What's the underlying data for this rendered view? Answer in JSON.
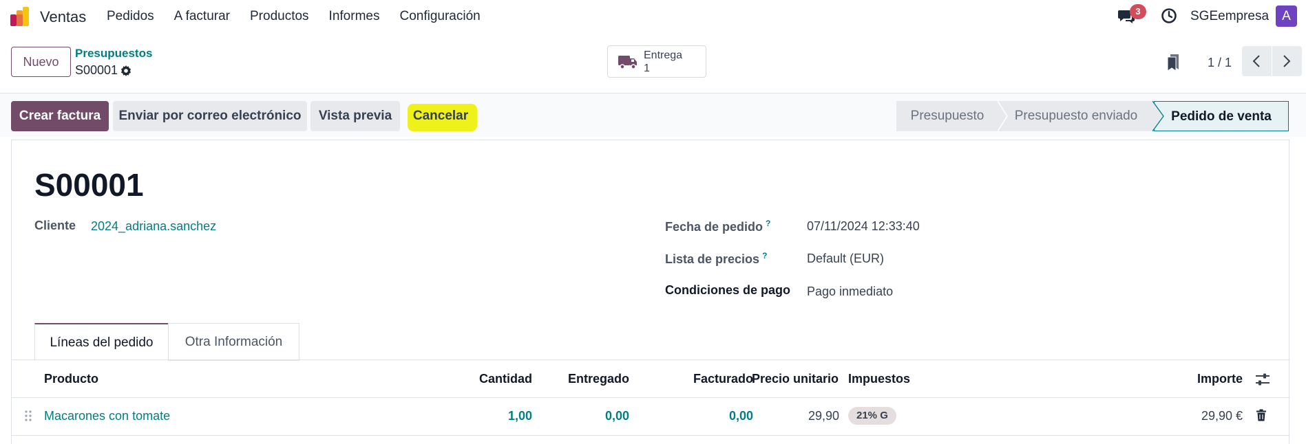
{
  "nav": {
    "app_name": "Ventas",
    "menu": [
      "Pedidos",
      "A facturar",
      "Productos",
      "Informes",
      "Configuración"
    ],
    "badge_count": "3",
    "company": "SGEempresa",
    "avatar_letter": "A"
  },
  "control": {
    "new_label": "Nuevo",
    "breadcrumb_parent": "Presupuestos",
    "breadcrumb_current": "S00001",
    "smart_label": "Entrega",
    "smart_value": "1",
    "pager": "1 / 1"
  },
  "actions": {
    "create_invoice": "Crear factura",
    "send_email": "Enviar por correo electrónico",
    "preview": "Vista previa",
    "cancel": "Cancelar"
  },
  "stages": [
    "Presupuesto",
    "Presupuesto enviado",
    "Pedido de venta"
  ],
  "form": {
    "name": "S00001",
    "customer_label": "Cliente",
    "customer_value": "2024_adriana.sanchez",
    "order_date_label": "Fecha de pedido",
    "order_date_value": "07/11/2024 12:33:40",
    "pricelist_label": "Lista de precios",
    "pricelist_value": "Default (EUR)",
    "payment_label": "Condiciones de pago",
    "payment_value": "Pago inmediato",
    "help_mark": "?"
  },
  "tabs": [
    "Líneas del pedido",
    "Otra Información"
  ],
  "table": {
    "headers": {
      "product": "Producto",
      "qty": "Cantidad",
      "delivered": "Entregado",
      "invoiced": "Facturado",
      "unit_price": "Precio unitario",
      "taxes": "Impuestos",
      "amount": "Importe"
    },
    "rows": [
      {
        "product": "Macarones con tomate",
        "qty": "1,00",
        "delivered": "0,00",
        "invoiced": "0,00",
        "unit_price": "29,90",
        "tax": "21% G",
        "amount": "29,90 €"
      }
    ]
  },
  "colors": {
    "brand": "#714b67",
    "link": "#017e84",
    "badge": "#d44c59",
    "highlight": "#eef21a"
  }
}
